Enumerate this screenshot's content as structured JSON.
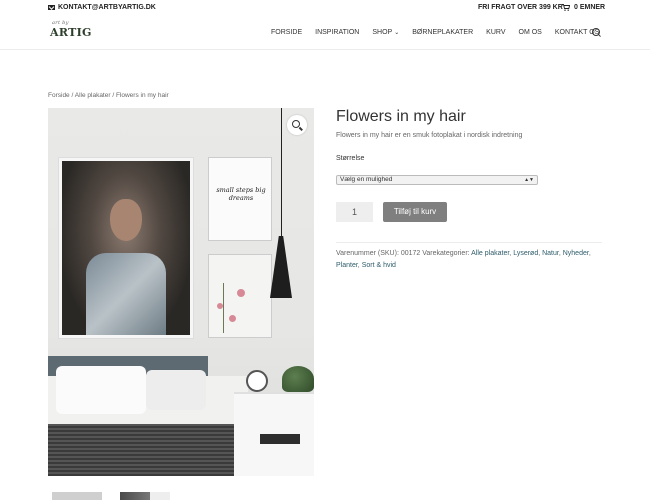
{
  "topbar": {
    "email": "KONTAKT@ARTBYARTIG.DK",
    "freight": "FRI FRAGT OVER 399 KR",
    "cart": "0 EMNER"
  },
  "header": {
    "logo": "ARTIG",
    "logo_small": "art by",
    "nav": [
      {
        "label": "FORSIDE"
      },
      {
        "label": "INSPIRATION"
      },
      {
        "label": "SHOP"
      },
      {
        "label": "BØRNEPLAKATER"
      },
      {
        "label": "KURV"
      },
      {
        "label": "OM OS"
      },
      {
        "label": "KONTAKT OS"
      }
    ]
  },
  "breadcrumb": {
    "home": "Forside",
    "sep1": " / ",
    "category": "Alle plakater",
    "sep2": " / ",
    "current": "Flowers in my hair"
  },
  "product": {
    "title": "Flowers in my hair",
    "description": "Flowers in my hair er en smuk fotoplakat i nordisk indretning",
    "size_label": "Størrelse",
    "size_select": "Vælg en mulighed",
    "quantity": "1",
    "add_to_cart": "Tilføj til kurv",
    "image_quote": "small steps big dreams",
    "meta": {
      "sku_label": "Varenummer (SKU): ",
      "sku": "00172",
      "categories_label": " Varekategorier: ",
      "categories": [
        "Alle plakater",
        "Lyserød",
        "Natur",
        "Nyheder",
        "Planter",
        "Sort & hvid"
      ]
    }
  },
  "colors": {
    "link": "#2f5d6b",
    "button": "#7f7f7f"
  }
}
